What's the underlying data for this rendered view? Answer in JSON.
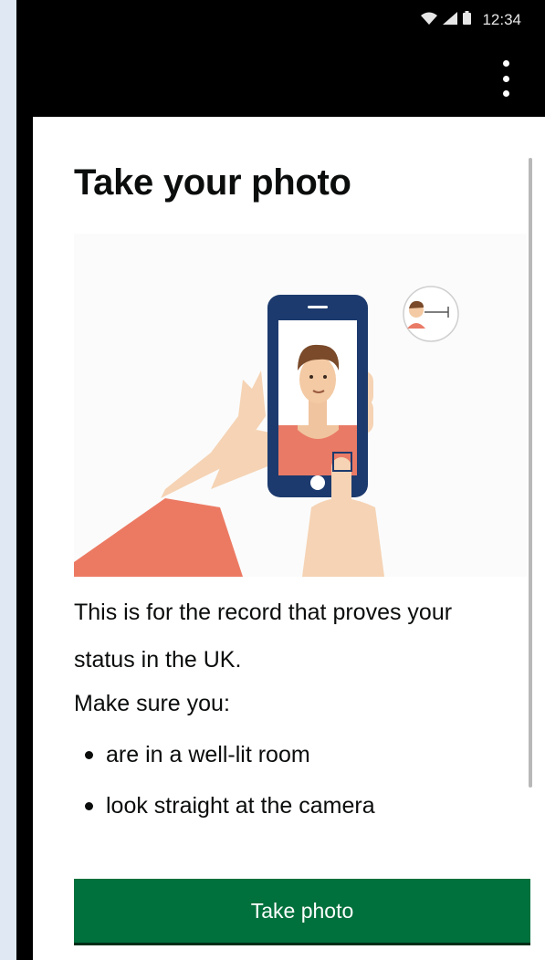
{
  "status_bar": {
    "time": "12:34",
    "icons": [
      "wifi-icon",
      "signal-icon",
      "battery-icon"
    ]
  },
  "page": {
    "title": "Take your photo",
    "paragraphs": [
      "This is for the record that proves your",
      "status in the UK.",
      "Make sure you:"
    ],
    "bullets": [
      "are in a well-lit room",
      "look straight at the camera"
    ],
    "button_label": "Take photo"
  },
  "colors": {
    "button": "#00703c",
    "text": "#0b0c0c",
    "background": "#ffffff"
  }
}
